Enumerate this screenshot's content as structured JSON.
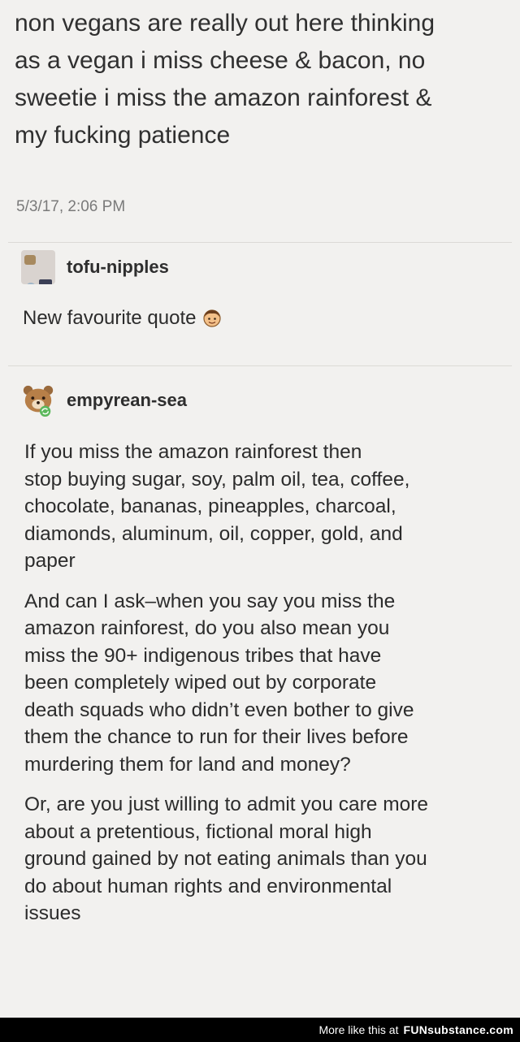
{
  "tweet": {
    "lines": [
      "non vegans are really out here thinking",
      "as a vegan i miss cheese & bacon, no",
      "sweetie i miss the amazon rainforest &",
      "my fucking patience"
    ],
    "timestamp": "5/3/17, 2:06 PM"
  },
  "reply1": {
    "username": "tofu-nipples",
    "text": "New favourite quote"
  },
  "reply2": {
    "username": "empyrean-sea",
    "paragraph1": [
      "If you miss the amazon rainforest then",
      "stop buying sugar, soy, palm oil, tea, coffee,",
      "chocolate, bananas, pineapples, charcoal,",
      "diamonds, aluminum, oil, copper, gold, and",
      "paper"
    ],
    "paragraph2": [
      "And can I ask–when you say you miss the",
      "amazon rainforest, do you also mean you",
      "miss the 90+ indigenous tribes that have",
      "been completely wiped out by corporate",
      "death squads who didn’t even bother to give",
      "them the chance to run for their lives before",
      "murdering them for land and money?"
    ],
    "paragraph3": [
      "Or, are you just willing to admit you care more",
      "about a pretentious, fictional moral high",
      "ground gained by not eating animals than you",
      "do about human rights and environmental",
      "issues"
    ]
  },
  "footer": {
    "text": "More like this at",
    "brand": "FUNsubstance.com"
  },
  "icons": {
    "reply1_emoji": "face-emoji-icon",
    "reply2_avatar": "bear-avatar-icon"
  },
  "colors": {
    "background": "#f2f1ef",
    "footer_bg": "#000000"
  }
}
